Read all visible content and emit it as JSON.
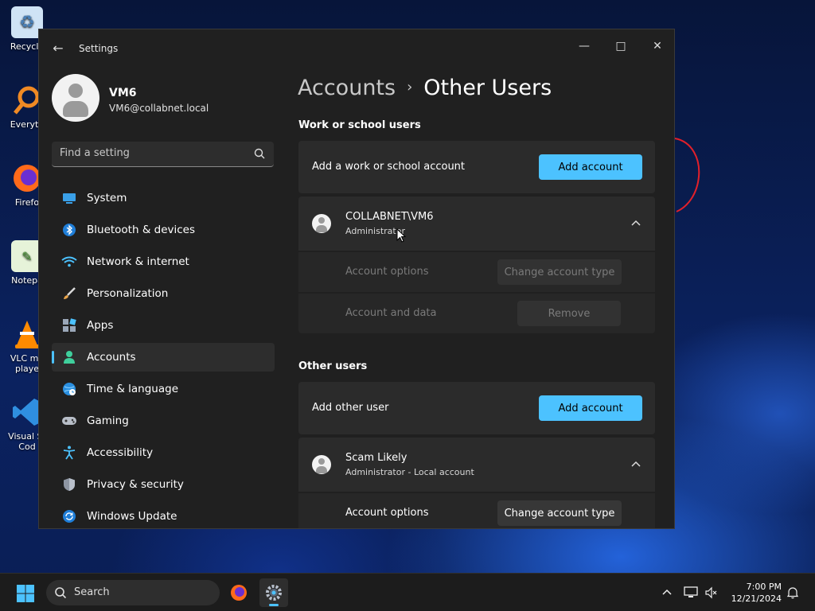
{
  "desktop": {
    "icons": [
      {
        "name": "recycle-bin",
        "label": "Recycle",
        "color": "#9fc3e6"
      },
      {
        "name": "everything",
        "label": "Everyth",
        "color": "#f08a24"
      },
      {
        "name": "firefox",
        "label": "Firefo",
        "color": "#ff6a1a"
      },
      {
        "name": "notepad",
        "label": "Notepa",
        "color": "#7fcf5a"
      },
      {
        "name": "vlc",
        "label": "VLC me\nplaye",
        "color": "#ff8a00"
      },
      {
        "name": "vscode",
        "label": "Visual St\nCod",
        "color": "#2f8fe0"
      }
    ]
  },
  "window": {
    "title": "Settings",
    "controls": {
      "minimize": "—",
      "maximize": "□",
      "close": "✕"
    }
  },
  "profile": {
    "name": "VM6",
    "email": "VM6@collabnet.local"
  },
  "search": {
    "placeholder": "Find a setting"
  },
  "nav": {
    "items": [
      {
        "label": "System",
        "icon": "system-icon",
        "active": false
      },
      {
        "label": "Bluetooth & devices",
        "icon": "bluetooth-icon",
        "active": false
      },
      {
        "label": "Network & internet",
        "icon": "network-icon",
        "active": false
      },
      {
        "label": "Personalization",
        "icon": "brush-icon",
        "active": false
      },
      {
        "label": "Apps",
        "icon": "apps-icon",
        "active": false
      },
      {
        "label": "Accounts",
        "icon": "accounts-icon",
        "active": true
      },
      {
        "label": "Time & language",
        "icon": "globe-clock-icon",
        "active": false
      },
      {
        "label": "Gaming",
        "icon": "gamepad-icon",
        "active": false
      },
      {
        "label": "Accessibility",
        "icon": "accessibility-icon",
        "active": false
      },
      {
        "label": "Privacy & security",
        "icon": "shield-icon",
        "active": false
      },
      {
        "label": "Windows Update",
        "icon": "update-icon",
        "active": false
      }
    ]
  },
  "breadcrumb": {
    "parent": "Accounts",
    "separator": "›",
    "current": "Other Users"
  },
  "work_section": {
    "heading": "Work or school users",
    "add_label": "Add a work or school account",
    "add_button": "Add account",
    "user": {
      "name": "COLLABNET\\VM6",
      "role": "Administrator",
      "account_options_label": "Account options",
      "change_type_button": "Change account type",
      "account_data_label": "Account and data",
      "remove_button": "Remove"
    }
  },
  "other_section": {
    "heading": "Other users",
    "add_label": "Add other user",
    "add_button": "Add account",
    "user": {
      "name": "Scam Likely",
      "role": "Administrator - Local account",
      "account_options_label": "Account options",
      "change_type_button": "Change account type"
    }
  },
  "taskbar": {
    "search_label": "Search",
    "time": "7:00 PM",
    "date": "12/21/2024"
  },
  "colors": {
    "accent": "#4cc2ff",
    "window_bg": "#202020",
    "card_bg": "#2b2b2b"
  }
}
